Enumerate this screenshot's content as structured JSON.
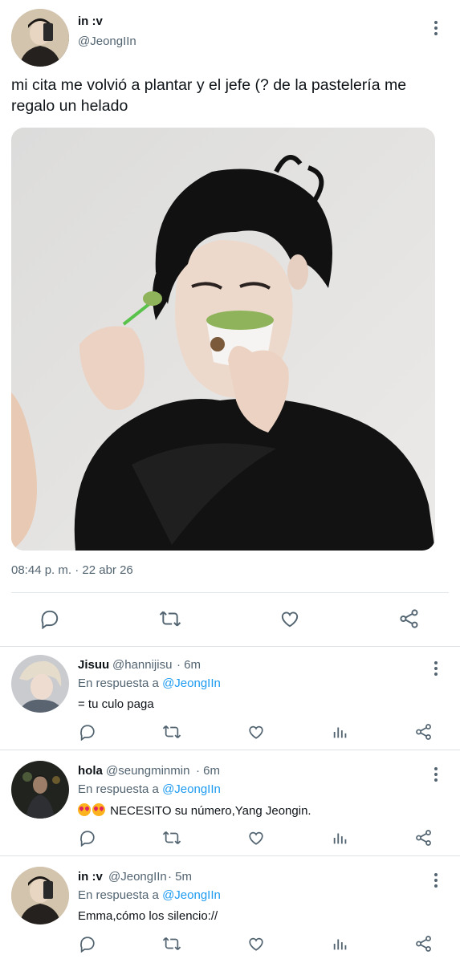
{
  "main_tweet": {
    "display_name": "in :v",
    "handle": "@JeongIIn",
    "text": "mi cita me volvió a plantar y el jefe (? de la pastelería me regalo un helado",
    "timestamp": "08:44 p. m. · 22 abr 26",
    "media_description_icon": "photo",
    "actions": [
      "reply-icon",
      "retweet-icon",
      "like-icon",
      "share-icon"
    ]
  },
  "replies": [
    {
      "display_name": "Jisuu",
      "handle": "@hannijisu",
      "time": "· 6m",
      "in_reply_prefix": "En respuesta a",
      "in_reply_to": "@JeongIIn",
      "emoji": "",
      "text": "= tu culo paga"
    },
    {
      "display_name": "hola",
      "handle": "@seungminmin",
      "time": "· 6m",
      "in_reply_prefix": "En respuesta a",
      "in_reply_to": "@JeongIIn",
      "emoji": "😍😍",
      "text": "NECESITO su número,Yang Jeongin."
    },
    {
      "display_name": "in :v",
      "handle": "@JeongIIn",
      "time": "· 5m",
      "in_reply_prefix": "En respuesta a",
      "in_reply_to": "@JeongIIn",
      "emoji": "",
      "text": "Emma,cómo los silencio://"
    }
  ],
  "colors": {
    "accent": "#1d9bf0",
    "text": "#0f1419",
    "secondary": "#536471",
    "divider": "#e1e6ea"
  }
}
